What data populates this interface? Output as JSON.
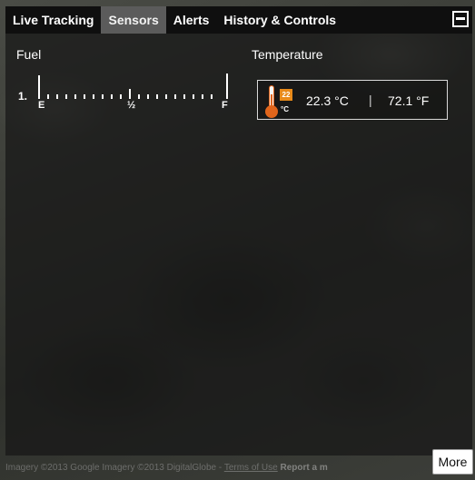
{
  "tabs": [
    {
      "label": "Live Tracking",
      "active": false
    },
    {
      "label": "Sensors",
      "active": true
    },
    {
      "label": "Alerts",
      "active": false
    },
    {
      "label": "History & Controls",
      "active": false
    }
  ],
  "fuel": {
    "label": "Fuel",
    "index": "1.",
    "empty_label": "E",
    "half_label": "½",
    "full_label": "F"
  },
  "temperature": {
    "label": "Temperature",
    "badge_value": "22",
    "badge_unit": "°C",
    "celsius": "22.3 °C",
    "separator": "|",
    "fahrenheit": "72.1 °F",
    "accent": "#e1651b"
  },
  "map": {
    "attribution": "Imagery ©2013 Google Imagery ©2013 DigitalGlobe -",
    "terms_link": "Terms of Use",
    "report_link": "Report a m",
    "more_button": "More"
  }
}
